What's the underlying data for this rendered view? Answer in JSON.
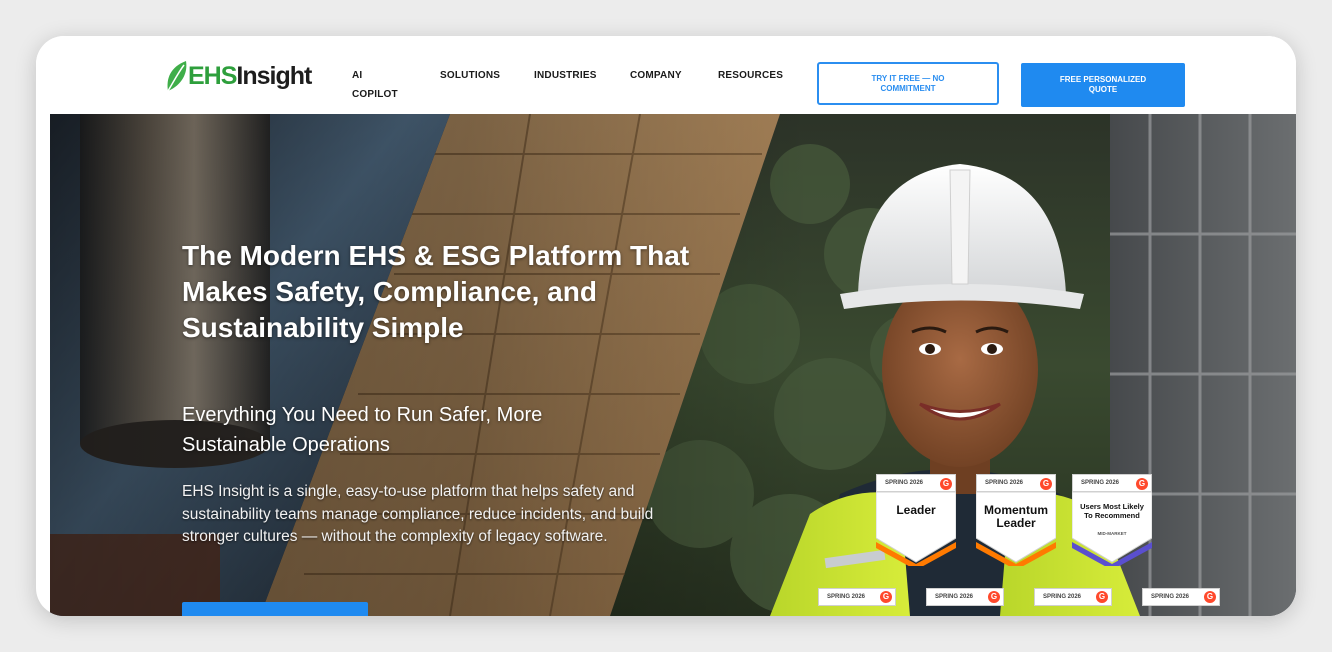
{
  "brand": {
    "logo_prefix": "EHS",
    "logo_suffix": "Insight",
    "logo_color": "#2e9f3c"
  },
  "nav": {
    "items": [
      {
        "label": "AI COPILOT"
      },
      {
        "label": "SOLUTIONS"
      },
      {
        "label": "INDUSTRIES"
      },
      {
        "label": "COMPANY"
      },
      {
        "label": "RESOURCES"
      }
    ],
    "try_free": "TRY IT FREE — NO COMMITMENT",
    "quote": "FREE PERSONALIZED QUOTE",
    "accent": "#1f8af0"
  },
  "hero": {
    "headline": "The Modern EHS & ESG Platform That Makes Safety, Compliance, and Sustainability Simple",
    "subheadline": "Everything You Need to Run Safer, More Sustainable Operations",
    "body": "EHS Insight is a single, easy-to-use platform that helps safety and sustainability teams manage compliance, reduce incidents, and build stronger cultures — without the complexity of legacy software.",
    "image_subject": "smiling worker in white hard hat and high-visibility vest"
  },
  "badges": [
    {
      "season": "SPRING 2026",
      "title": "Leader",
      "sub": ""
    },
    {
      "season": "SPRING 2026",
      "title": "Momentum Leader",
      "sub": ""
    },
    {
      "season": "SPRING 2026",
      "title": "Users Most Likely To Recommend",
      "sub": "MID-MARKET"
    }
  ],
  "mini_badges": [
    {
      "season": "SPRING 2026"
    },
    {
      "season": "SPRING 2026"
    },
    {
      "season": "SPRING 2026"
    },
    {
      "season": "SPRING 2026"
    }
  ],
  "g2_glyph": "G"
}
